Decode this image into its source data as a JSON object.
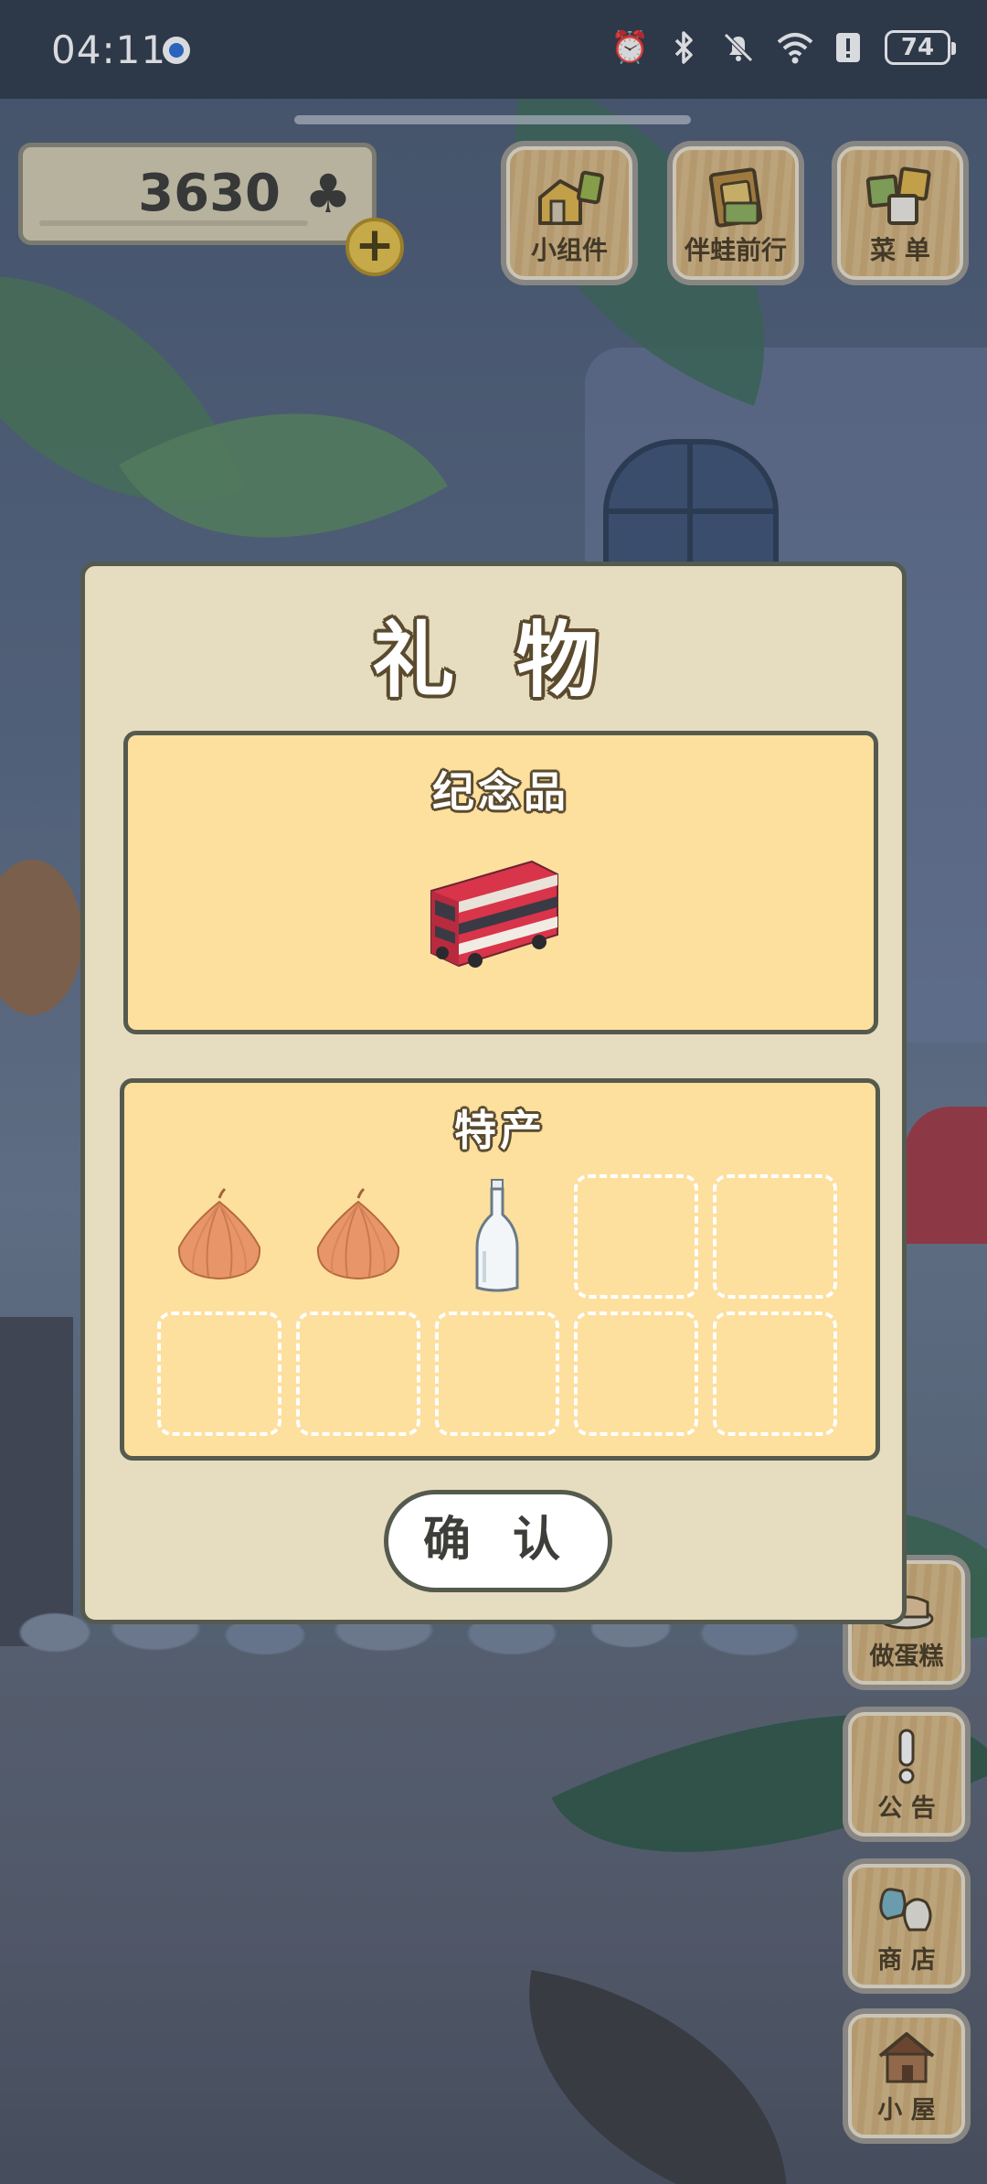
{
  "status_bar": {
    "time": "04:11",
    "battery": "74",
    "icons": [
      "location-icon",
      "alarm-icon",
      "bluetooth-icon",
      "mute-icon",
      "wifi-icon",
      "alert-icon",
      "battery-icon"
    ]
  },
  "hud": {
    "clover_count": "3630",
    "buttons": [
      {
        "label": "小组件",
        "icon": "widget-icon"
      },
      {
        "label": "伴蛙前行",
        "icon": "journey-book-icon"
      },
      {
        "label": "菜 单",
        "icon": "menu-icon"
      }
    ]
  },
  "side_buttons": [
    {
      "label": "做蛋糕",
      "icon": "cake-icon"
    },
    {
      "label": "公 告",
      "icon": "exclamation-icon"
    },
    {
      "label": "商 店",
      "icon": "shop-bag-icon"
    },
    {
      "label": "小 屋",
      "icon": "house-icon"
    }
  ],
  "dialog": {
    "title": "礼 物",
    "souvenir": {
      "title": "纪念品",
      "item": "red-double-decker-bus"
    },
    "specialty": {
      "title": "特产",
      "slots": [
        "onion",
        "onion",
        "glass-bottle",
        "empty",
        "empty",
        "empty",
        "empty",
        "empty",
        "empty",
        "empty"
      ]
    },
    "confirm_label": "确 认"
  },
  "colors": {
    "panel": "#fddf9e",
    "dialog": "#e6dcc0",
    "border": "#555a4e",
    "bus_red": "#d8344a",
    "onion": "#e9956a"
  }
}
